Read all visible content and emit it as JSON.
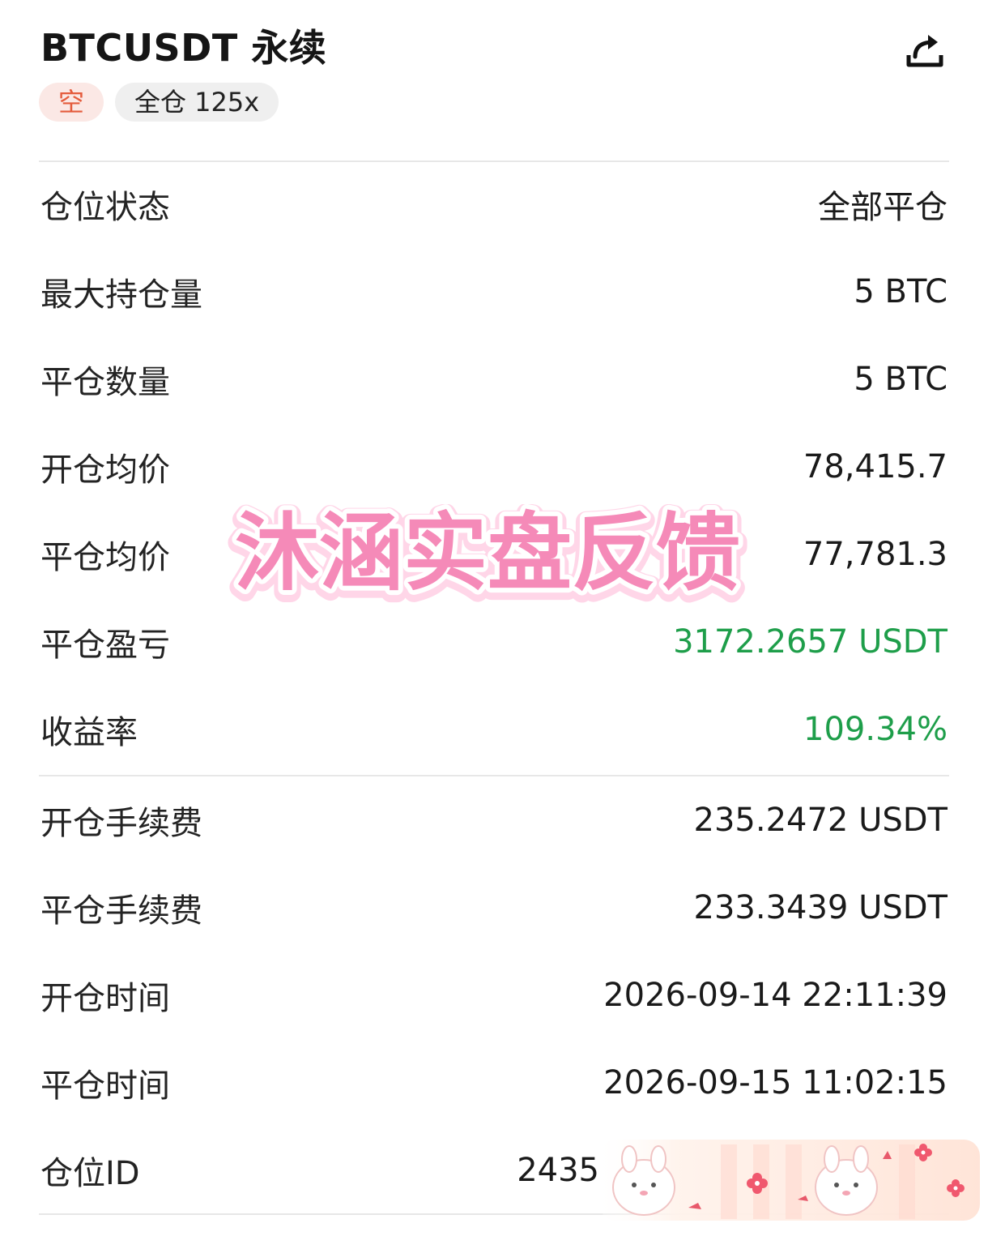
{
  "header": {
    "title": "BTCUSDT 永续",
    "share_icon": "share-icon"
  },
  "tags": {
    "direction": "空",
    "margin_mode": "全仓 125x"
  },
  "rows": [
    {
      "label": "仓位状态",
      "value": "全部平仓"
    },
    {
      "label": "最大持仓量",
      "value": "5 BTC"
    },
    {
      "label": "平仓数量",
      "value": "5 BTC"
    },
    {
      "label": "开仓均价",
      "value": "78,415.7"
    },
    {
      "label": "平仓均价",
      "value": "77,781.3"
    },
    {
      "label": "平仓盈亏",
      "value": "3172.2657 USDT"
    },
    {
      "label": "收益率",
      "value": "109.34%"
    },
    {
      "label": "开仓手续费",
      "value": "235.2472 USDT"
    },
    {
      "label": "平仓手续费",
      "value": "233.3439 USDT"
    },
    {
      "label": "开仓时间",
      "value": "2026-09-14 22:11:39"
    },
    {
      "label": "平仓时间",
      "value": "2026-09-15 11:02:15"
    },
    {
      "label": "仓位ID",
      "value": "2435"
    }
  ],
  "watermark": {
    "text": "沐涵实盘反馈"
  },
  "colors": {
    "profit_green": "#1e9e4a",
    "short_red": "#e45b3c",
    "short_bg": "#fbe8e5",
    "watermark_pink": "#f58ab8"
  }
}
